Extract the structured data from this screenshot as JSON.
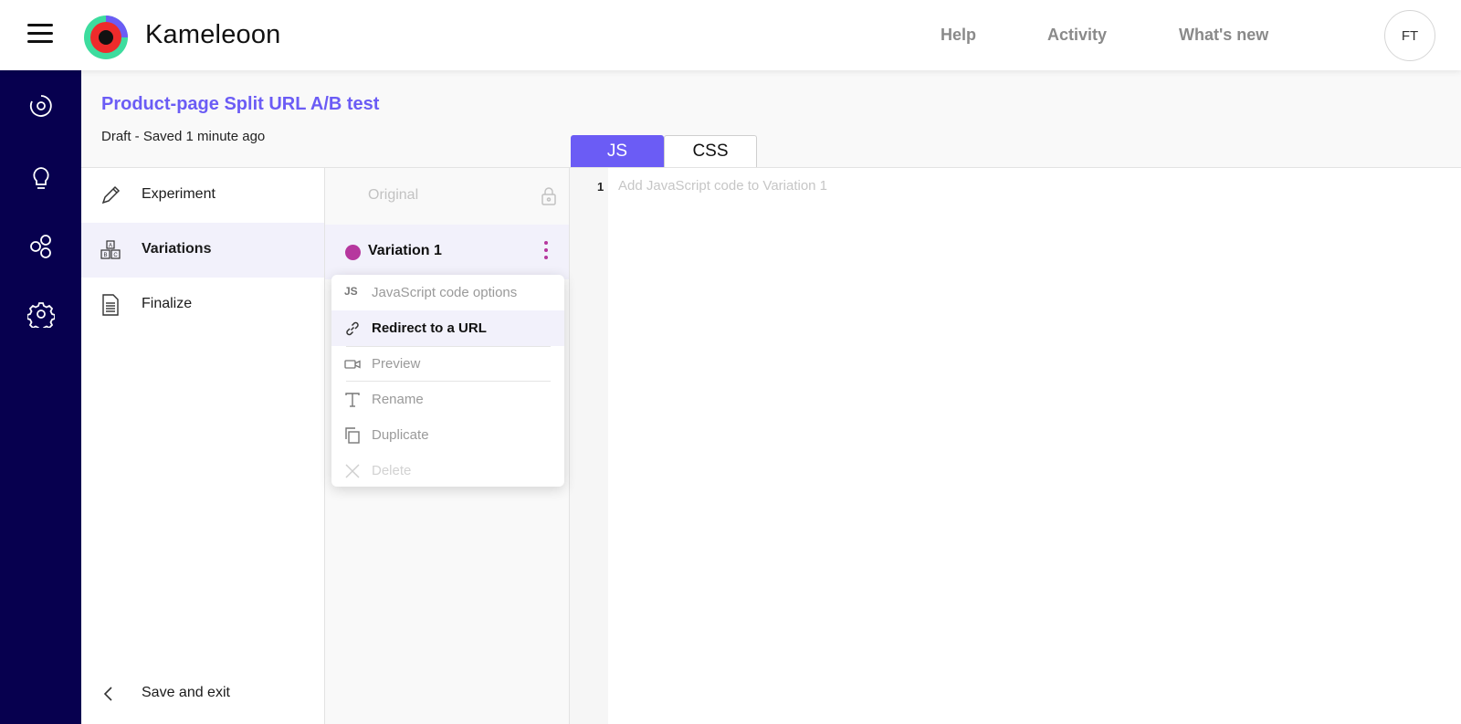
{
  "app": {
    "brand": "Kameleoon",
    "accent": "#6b5cf5",
    "rail_bg": "#07004f"
  },
  "topnav": {
    "help": "Help",
    "activity": "Activity",
    "whats_new": "What's new",
    "avatar": "FT"
  },
  "rail": {
    "icons": [
      "target-icon",
      "lightbulb-icon",
      "integrations-icon",
      "settings-icon"
    ]
  },
  "header": {
    "title": "Product-page Split URL A/B test",
    "status": "Draft - Saved 1 minute ago"
  },
  "tabs": {
    "js": "JS",
    "css": "CSS",
    "active": "JS"
  },
  "leftnav": {
    "items": [
      {
        "label": "Experiment",
        "icon": "pencil-icon"
      },
      {
        "label": "Variations",
        "icon": "abc-blocks-icon",
        "active": true
      },
      {
        "label": "Finalize",
        "icon": "document-icon"
      }
    ],
    "save_exit": "Save and exit"
  },
  "variations": {
    "original": "Original",
    "v1": {
      "label": "Variation 1",
      "color": "#b6379e"
    }
  },
  "menu": {
    "items": [
      {
        "label": "JavaScript code options",
        "icon": "JS"
      },
      {
        "label": "Redirect to a URL",
        "icon": "link-icon",
        "highlighted": true
      },
      {
        "label": "Preview",
        "icon": "video-icon"
      },
      {
        "label": "Rename",
        "icon": "text-icon"
      },
      {
        "label": "Duplicate",
        "icon": "copy-icon"
      },
      {
        "label": "Delete",
        "icon": "close-icon",
        "disabled": true
      }
    ]
  },
  "editor": {
    "line": "1",
    "placeholder": "Add JavaScript code to Variation 1"
  }
}
